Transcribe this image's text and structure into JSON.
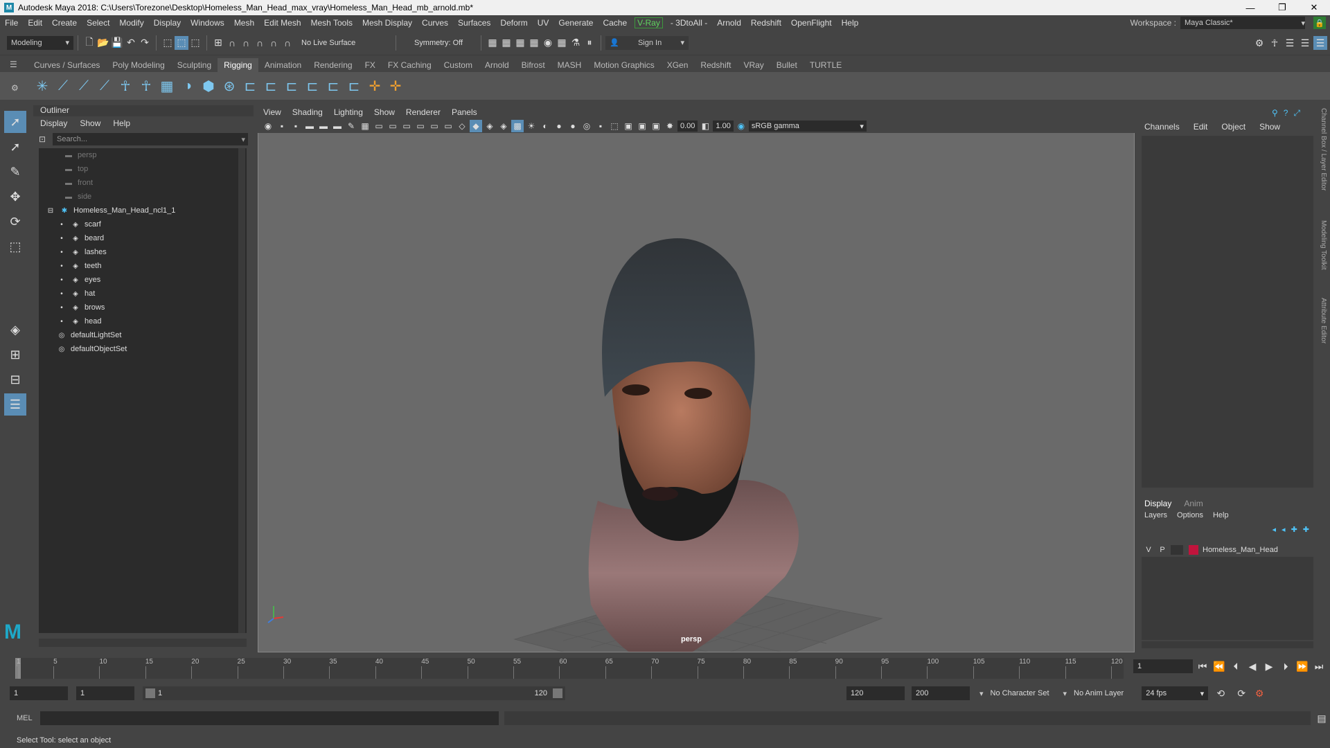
{
  "window": {
    "title": "Autodesk Maya 2018: C:\\Users\\Torezone\\Desktop\\Homeless_Man_Head_max_vray\\Homeless_Man_Head_mb_arnold.mb*",
    "logo": "M"
  },
  "menubar": {
    "items": [
      "File",
      "Edit",
      "Create",
      "Select",
      "Modify",
      "Display",
      "Windows",
      "Mesh",
      "Edit Mesh",
      "Mesh Tools",
      "Mesh Display",
      "Curves",
      "Surfaces",
      "Deform",
      "UV",
      "Generate",
      "Cache"
    ],
    "vray": "V-Ray",
    "items2": [
      "- 3DtoAll -",
      "Arnold",
      "Redshift",
      "OpenFlight",
      "Help"
    ],
    "workspace_label": "Workspace :",
    "workspace_value": "Maya Classic*"
  },
  "statusline": {
    "mode": "Modeling",
    "live_surface": "No Live Surface",
    "symmetry": "Symmetry: Off",
    "sign_in": "Sign In"
  },
  "shelf": {
    "tabs": [
      "Curves / Surfaces",
      "Poly Modeling",
      "Sculpting",
      "Rigging",
      "Animation",
      "Rendering",
      "FX",
      "FX Caching",
      "Custom",
      "Arnold",
      "Bifrost",
      "MASH",
      "Motion Graphics",
      "XGen",
      "Redshift",
      "VRay",
      "Bullet",
      "TURTLE"
    ],
    "active_tab": "Rigging"
  },
  "outliner": {
    "title": "Outliner",
    "menu": [
      "Display",
      "Show",
      "Help"
    ],
    "search_placeholder": "Search...",
    "cameras": [
      "persp",
      "top",
      "front",
      "side"
    ],
    "group": "Homeless_Man_Head_ncl1_1",
    "children": [
      "scarf",
      "beard",
      "lashes",
      "teeth",
      "eyes",
      "hat",
      "brows",
      "head"
    ],
    "sets": [
      "defaultLightSet",
      "defaultObjectSet"
    ]
  },
  "viewport": {
    "menu": [
      "View",
      "Shading",
      "Lighting",
      "Show",
      "Renderer",
      "Panels"
    ],
    "exposure": "0.00",
    "gamma": "1.00",
    "color_space": "sRGB gamma",
    "camera_label": "persp"
  },
  "channelbox": {
    "menu": [
      "Channels",
      "Edit",
      "Object",
      "Show"
    ]
  },
  "layers": {
    "tabs": [
      "Display",
      "Anim"
    ],
    "menu": [
      "Layers",
      "Options",
      "Help"
    ],
    "layer": {
      "v": "V",
      "p": "P",
      "name": "Homeless_Man_Head",
      "color": "#c0143c"
    }
  },
  "sidetabs": [
    "Channel Box / Layer Editor",
    "Modeling Toolkit",
    "Attribute Editor"
  ],
  "timeline": {
    "ticks": [
      "1",
      "5",
      "10",
      "15",
      "20",
      "25",
      "30",
      "35",
      "40",
      "45",
      "50",
      "55",
      "60",
      "65",
      "70",
      "75",
      "80",
      "85",
      "90",
      "95",
      "100",
      "105",
      "110",
      "115",
      "120"
    ],
    "current_frame": "1"
  },
  "range": {
    "start": "1",
    "playback_start": "1",
    "slider_start": "1",
    "slider_end": "120",
    "playback_end": "120",
    "end": "200",
    "character_set": "No Character Set",
    "anim_layer": "No Anim Layer",
    "fps": "24 fps"
  },
  "cmdline": {
    "label": "MEL"
  },
  "helpline": {
    "text": "Select Tool: select an object"
  }
}
